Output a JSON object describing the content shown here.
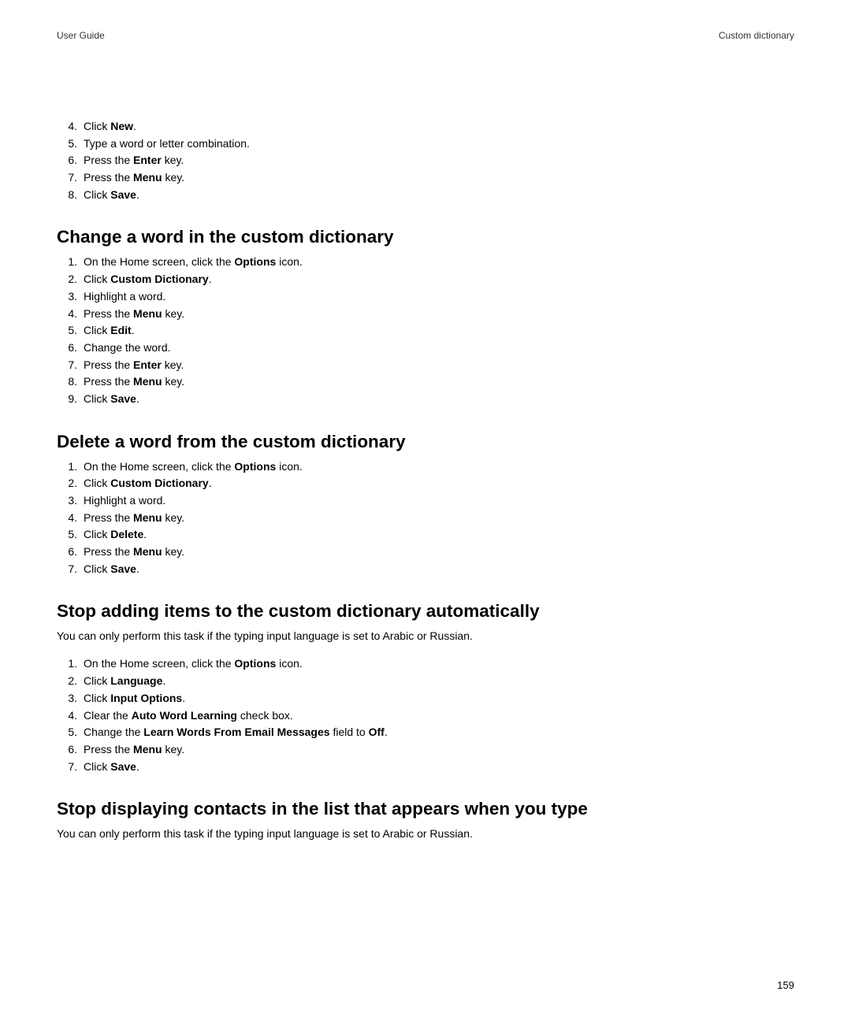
{
  "header": {
    "left": "User Guide",
    "right": "Custom dictionary"
  },
  "intro_list": [
    {
      "n": "4.",
      "parts": [
        {
          "t": "Click "
        },
        {
          "t": "New",
          "b": true
        },
        {
          "t": "."
        }
      ]
    },
    {
      "n": "5.",
      "parts": [
        {
          "t": "Type a word or letter combination."
        }
      ]
    },
    {
      "n": "6.",
      "parts": [
        {
          "t": "Press the "
        },
        {
          "t": "Enter",
          "b": true
        },
        {
          "t": " key."
        }
      ]
    },
    {
      "n": "7.",
      "parts": [
        {
          "t": "Press the "
        },
        {
          "t": "Menu",
          "b": true
        },
        {
          "t": " key."
        }
      ]
    },
    {
      "n": "8.",
      "parts": [
        {
          "t": "Click "
        },
        {
          "t": "Save",
          "b": true
        },
        {
          "t": "."
        }
      ]
    }
  ],
  "sections": [
    {
      "heading": "Change a word in the custom dictionary",
      "note": "",
      "items": [
        {
          "n": "1.",
          "parts": [
            {
              "t": "On the Home screen, click the "
            },
            {
              "t": "Options",
              "b": true
            },
            {
              "t": " icon."
            }
          ]
        },
        {
          "n": "2.",
          "parts": [
            {
              "t": "Click "
            },
            {
              "t": "Custom Dictionary",
              "b": true
            },
            {
              "t": "."
            }
          ]
        },
        {
          "n": "3.",
          "parts": [
            {
              "t": "Highlight a word."
            }
          ]
        },
        {
          "n": "4.",
          "parts": [
            {
              "t": "Press the "
            },
            {
              "t": "Menu",
              "b": true
            },
            {
              "t": " key."
            }
          ]
        },
        {
          "n": "5.",
          "parts": [
            {
              "t": "Click "
            },
            {
              "t": "Edit",
              "b": true
            },
            {
              "t": "."
            }
          ]
        },
        {
          "n": "6.",
          "parts": [
            {
              "t": "Change the word."
            }
          ]
        },
        {
          "n": "7.",
          "parts": [
            {
              "t": "Press the "
            },
            {
              "t": "Enter",
              "b": true
            },
            {
              "t": " key."
            }
          ]
        },
        {
          "n": "8.",
          "parts": [
            {
              "t": "Press the "
            },
            {
              "t": "Menu",
              "b": true
            },
            {
              "t": " key."
            }
          ]
        },
        {
          "n": "9.",
          "parts": [
            {
              "t": "Click "
            },
            {
              "t": "Save",
              "b": true
            },
            {
              "t": "."
            }
          ]
        }
      ]
    },
    {
      "heading": "Delete a word from the custom dictionary",
      "note": "",
      "items": [
        {
          "n": "1.",
          "parts": [
            {
              "t": "On the Home screen, click the "
            },
            {
              "t": "Options",
              "b": true
            },
            {
              "t": " icon."
            }
          ]
        },
        {
          "n": "2.",
          "parts": [
            {
              "t": "Click "
            },
            {
              "t": "Custom Dictionary",
              "b": true
            },
            {
              "t": "."
            }
          ]
        },
        {
          "n": "3.",
          "parts": [
            {
              "t": "Highlight a word."
            }
          ]
        },
        {
          "n": "4.",
          "parts": [
            {
              "t": "Press the "
            },
            {
              "t": "Menu",
              "b": true
            },
            {
              "t": " key."
            }
          ]
        },
        {
          "n": "5.",
          "parts": [
            {
              "t": "Click "
            },
            {
              "t": "Delete",
              "b": true
            },
            {
              "t": "."
            }
          ]
        },
        {
          "n": "6.",
          "parts": [
            {
              "t": "Press the "
            },
            {
              "t": "Menu",
              "b": true
            },
            {
              "t": " key."
            }
          ]
        },
        {
          "n": "7.",
          "parts": [
            {
              "t": "Click "
            },
            {
              "t": "Save",
              "b": true
            },
            {
              "t": "."
            }
          ]
        }
      ]
    },
    {
      "heading": "Stop adding items to the custom dictionary automatically",
      "note": "You can only perform this task if the typing input language is set to Arabic or Russian.",
      "items": [
        {
          "n": "1.",
          "parts": [
            {
              "t": "On the Home screen, click the "
            },
            {
              "t": "Options",
              "b": true
            },
            {
              "t": " icon."
            }
          ]
        },
        {
          "n": "2.",
          "parts": [
            {
              "t": "Click "
            },
            {
              "t": "Language",
              "b": true
            },
            {
              "t": "."
            }
          ]
        },
        {
          "n": "3.",
          "parts": [
            {
              "t": "Click "
            },
            {
              "t": "Input Options",
              "b": true
            },
            {
              "t": "."
            }
          ]
        },
        {
          "n": "4.",
          "parts": [
            {
              "t": "Clear the "
            },
            {
              "t": "Auto Word Learning",
              "b": true
            },
            {
              "t": " check box."
            }
          ]
        },
        {
          "n": "5.",
          "parts": [
            {
              "t": "Change the "
            },
            {
              "t": "Learn Words From Email Messages",
              "b": true
            },
            {
              "t": " field to "
            },
            {
              "t": "Off",
              "b": true
            },
            {
              "t": "."
            }
          ]
        },
        {
          "n": "6.",
          "parts": [
            {
              "t": "Press the "
            },
            {
              "t": "Menu",
              "b": true
            },
            {
              "t": " key."
            }
          ]
        },
        {
          "n": "7.",
          "parts": [
            {
              "t": "Click "
            },
            {
              "t": "Save",
              "b": true
            },
            {
              "t": "."
            }
          ]
        }
      ]
    },
    {
      "heading": "Stop displaying contacts in the list that appears when you type",
      "note": "You can only perform this task if the typing input language is set to Arabic or Russian.",
      "items": []
    }
  ],
  "page_number": "159"
}
